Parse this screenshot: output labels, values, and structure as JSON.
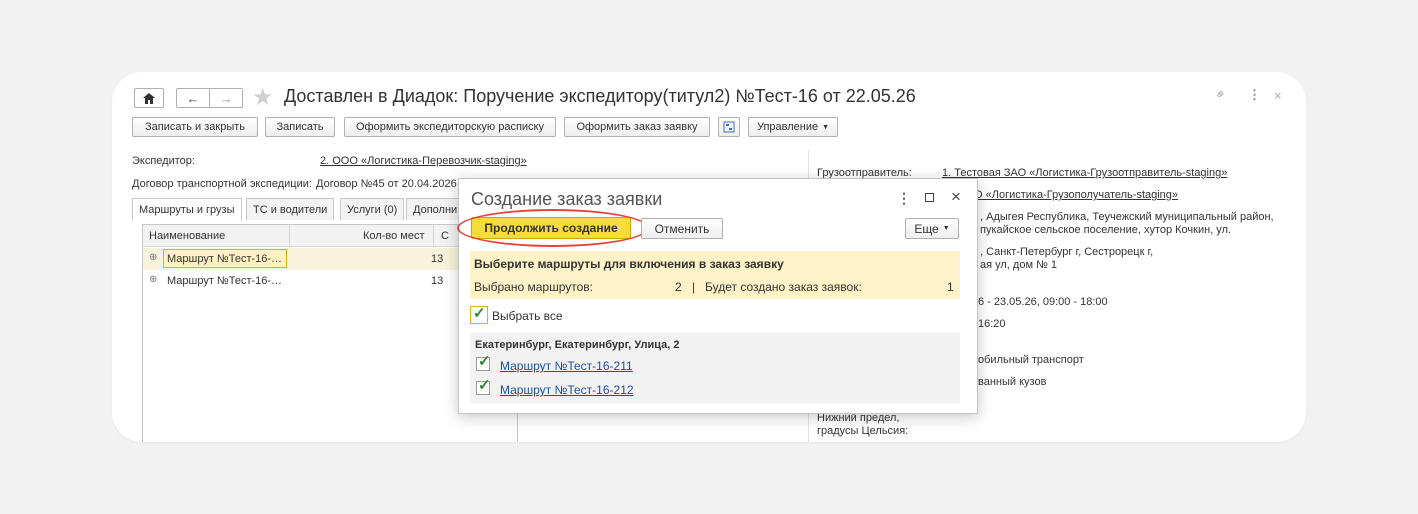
{
  "window": {
    "title": "Доставлен в Диадок: Поручение экспедитору(титул2) №Тест-16 от 22.05.26"
  },
  "toolbar": {
    "save_close": "Записать и закрыть",
    "save": "Записать",
    "receipt": "Оформить экспедиторскую расписку",
    "order": "Оформить заказ заявку",
    "manage": "Управление"
  },
  "form": {
    "expeditor_label": "Экспедитор:",
    "expeditor_value": "2. ООО «Логистика-Перевозчик-staging»",
    "contract_label": "Договор транспортной экспедиции:",
    "contract_value": "Договор №45 от 20.04.2026"
  },
  "tabs": [
    {
      "label": "Маршруты и грузы"
    },
    {
      "label": "ТС и водители"
    },
    {
      "label": "Услуги (0)"
    },
    {
      "label": "Дополни"
    }
  ],
  "grid": {
    "col_name": "Наименование",
    "col_places": "Кол-во мест",
    "col_extra": "С",
    "rows": [
      {
        "name": "Маршрут №Тест-16-…",
        "places": "13"
      },
      {
        "name": "Маршрут №Тест-16-…",
        "places": "13"
      }
    ]
  },
  "right": {
    "shipper_label": "Грузоотправитель:",
    "shipper_value": "1. Тестовая ЗАО «Логистика-Грузоотправитель-staging»",
    "consignee_value": "О «Логистика-Грузополучатель-staging»",
    "addr1_line1": ", Адыгея Республика, Теучежский муниципальный район,",
    "addr1_line2": "пукайское сельское поселение, хутор Кочкин, ул.",
    "addr2_line1": ", Санкт-Петербург г, Сестрорецк г,",
    "addr2_line2": "ая ул, дом № 1",
    "date_range": "6 - 23.05.26, 09:00 - 18:00",
    "time": "16:20",
    "transport": "обильный транспорт",
    "body": "ванный кузов",
    "lower_limit_line1": "Нижний предел,",
    "lower_limit_line2": "градусы Цельсия:"
  },
  "dialog": {
    "title": "Создание заказ заявки",
    "continue": "Продолжить создание",
    "cancel": "Отменить",
    "more": "Еще",
    "info_heading": "Выберите маршруты для включения в заказ заявку",
    "selected_label": "Выбрано маршрутов:",
    "selected_count": "2",
    "separator": "|",
    "will_create_label": "Будет создано заказ заявок:",
    "will_create_count": "1",
    "select_all": "Выбрать все",
    "group_title": "Екатеринбург, Екатеринбург, Улица, 2",
    "routes": [
      {
        "label": "Маршрут №Тест-16-211"
      },
      {
        "label": "Маршрут №Тест-16-212"
      }
    ]
  }
}
